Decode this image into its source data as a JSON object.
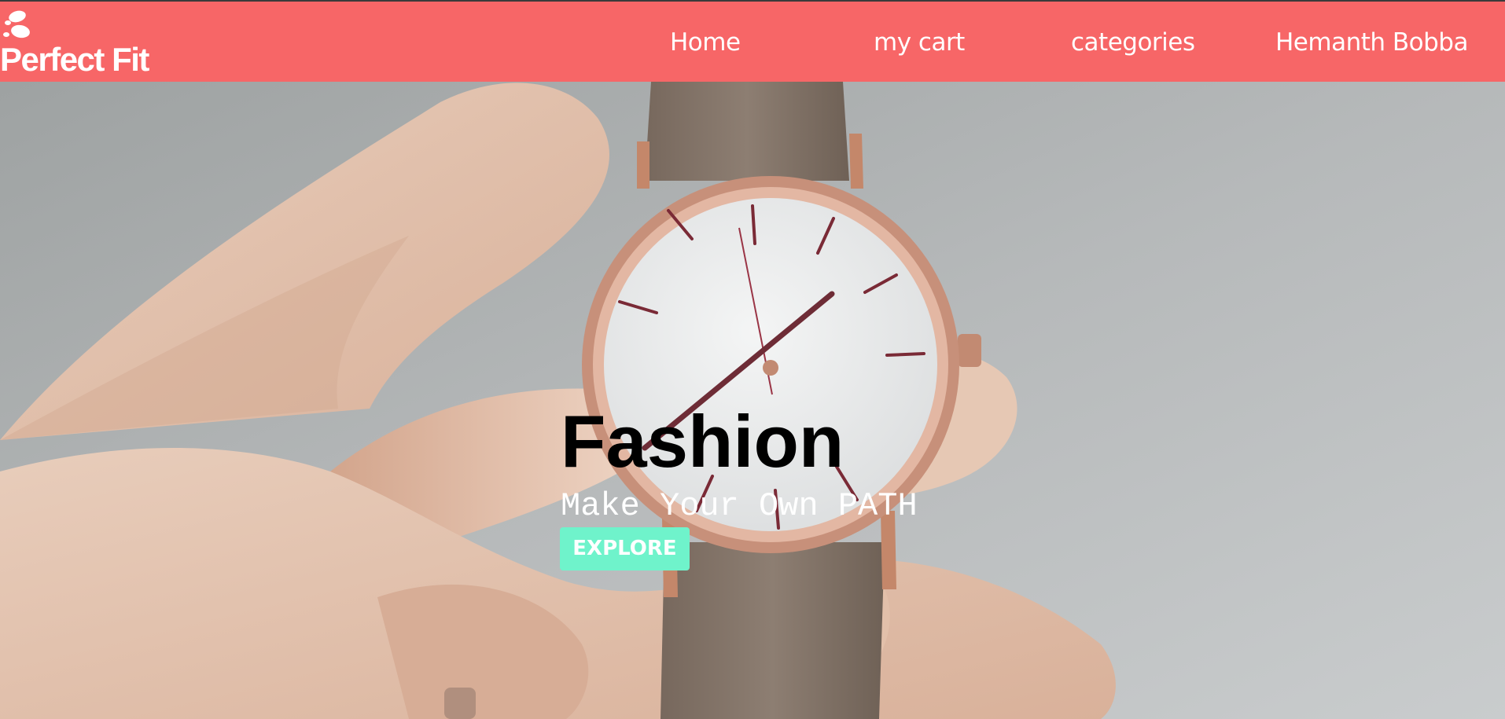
{
  "header": {
    "brand": "Perfect Fit",
    "brand_icon": "footprints-icon",
    "nav": {
      "home": "Home",
      "cart": "my cart",
      "categories": "categories",
      "user": "Hemanth Bobba"
    }
  },
  "hero": {
    "title": "Fashion",
    "subtitle": "Make Your Own PATH",
    "explore_label": "EXPLORE",
    "background_image": "hand holding wristwatch"
  },
  "colors": {
    "navbar": "#f76667",
    "accent": "#6ff3cb",
    "text_light": "#ffffff",
    "text_dark": "#000000"
  }
}
